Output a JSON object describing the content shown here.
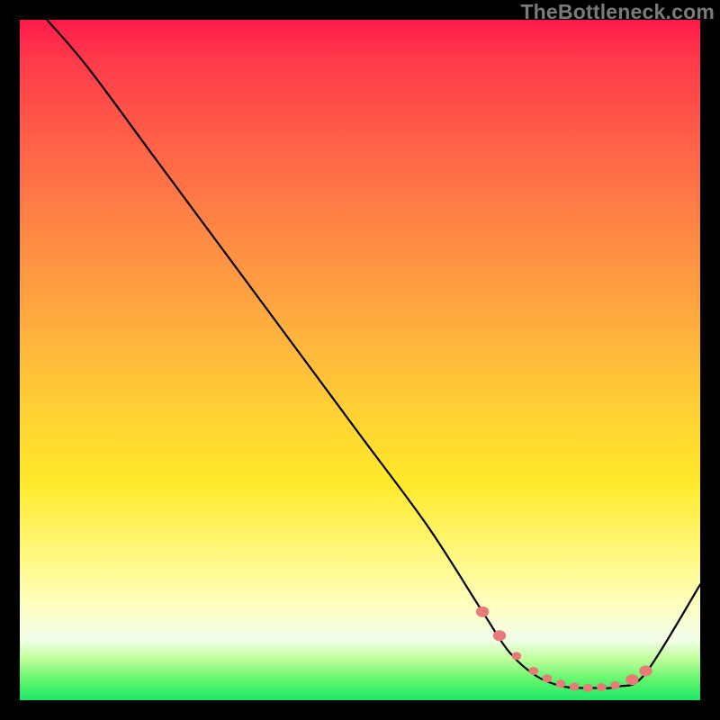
{
  "watermark": "TheBottleneck.com",
  "chart_data": {
    "type": "line",
    "title": "",
    "xlabel": "",
    "ylabel": "",
    "xlim": [
      0,
      100
    ],
    "ylim": [
      0,
      100
    ],
    "series": [
      {
        "name": "curve",
        "x": [
          4,
          10,
          20,
          30,
          40,
          50,
          60,
          68,
          72,
          76,
          80,
          84,
          88,
          92,
          100
        ],
        "values": [
          100,
          93,
          79.5,
          66,
          52.5,
          39,
          25.5,
          13,
          7,
          3.5,
          2,
          1.8,
          2,
          4,
          17
        ]
      }
    ],
    "markers": {
      "name": "highlight-dots",
      "color": "#e87a78",
      "x": [
        68,
        70.5,
        73,
        75.5,
        77.5,
        79.5,
        81.5,
        83.5,
        85.5,
        87.5,
        90,
        92
      ],
      "values": [
        13,
        9.5,
        6.5,
        4.3,
        3.2,
        2.4,
        2.0,
        1.8,
        1.9,
        2.2,
        3.0,
        4.3
      ]
    }
  }
}
